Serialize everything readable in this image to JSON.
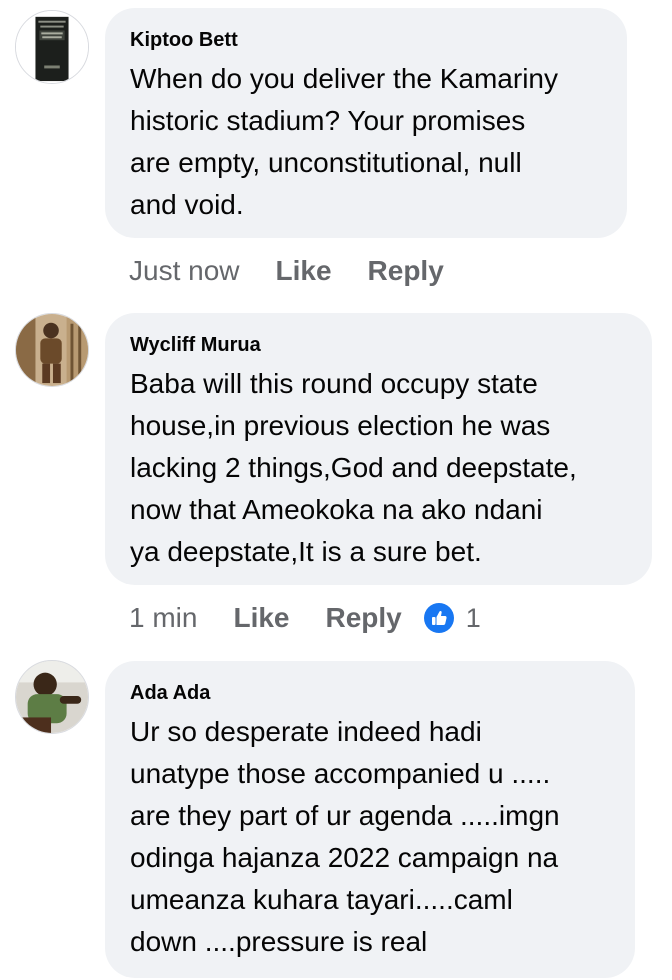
{
  "comments": [
    {
      "author": "Kiptoo Bett",
      "text": "When do you deliver the Kamariny\nhistoric stadium? Your promises\nare    empty, unconstitutional, null\nand void.",
      "time": "Just now",
      "like_label": "Like",
      "reply_label": "Reply",
      "avatar_icon": "book-avatar-icon"
    },
    {
      "author": "Wycliff Murua",
      "text": "Baba will this round occupy state\nhouse,in previous election he was\nlacking 2 things,God and deepstate,\nnow that Ameokoka na ako ndani\nya deepstate,It is a sure bet.",
      "time": "1 min",
      "like_label": "Like",
      "reply_label": "Reply",
      "reaction_count": "1",
      "reaction_icon": "like-reaction-icon",
      "avatar_icon": "person-avatar-icon"
    },
    {
      "author": "Ada Ada",
      "text": "Ur so desperate indeed hadi\nunatype those accompanied u .....\nare they part of ur agenda .....imgn\nodinga hajanza 2022 campaign na\numeanza kuhara tayari.....caml\ndown ....pressure is real",
      "avatar_icon": "person-avatar-icon"
    }
  ],
  "colors": {
    "bubble": "#f0f2f5",
    "text": "#050505",
    "meta": "#65676b",
    "like_blue": "#1877f2"
  }
}
